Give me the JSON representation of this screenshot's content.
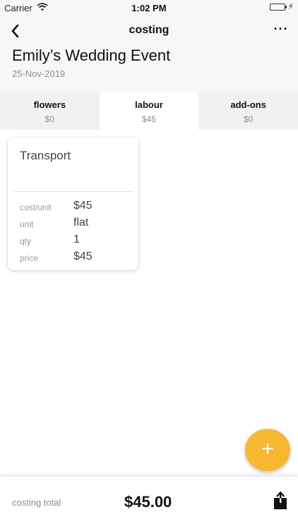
{
  "status_bar": {
    "carrier": "Carrier",
    "time": "1:02 PM",
    "battery_color": "#4cd964"
  },
  "nav": {
    "title": "costing",
    "back_icon": "chevron-left-icon",
    "more_label": "···"
  },
  "event": {
    "title": "Emily’s Wedding Event",
    "date": "25-Nov-2019"
  },
  "tabs": [
    {
      "name": "flowers",
      "amount": "$0",
      "active": false
    },
    {
      "name": "labour",
      "amount": "$45",
      "active": true
    },
    {
      "name": "add-ons",
      "amount": "$0",
      "active": false
    }
  ],
  "item_card": {
    "title": "Transport",
    "rows": [
      {
        "label": "cost/unit",
        "value": "$45"
      },
      {
        "label": "unit",
        "value": "flat"
      },
      {
        "label": "qty",
        "value": "1"
      },
      {
        "label": "price",
        "value": "$45"
      }
    ]
  },
  "fab": {
    "label": "+",
    "color": "#f5b830"
  },
  "footer": {
    "total_label": "costing total",
    "total_amount": "$45.00",
    "share_icon": "share-icon"
  }
}
